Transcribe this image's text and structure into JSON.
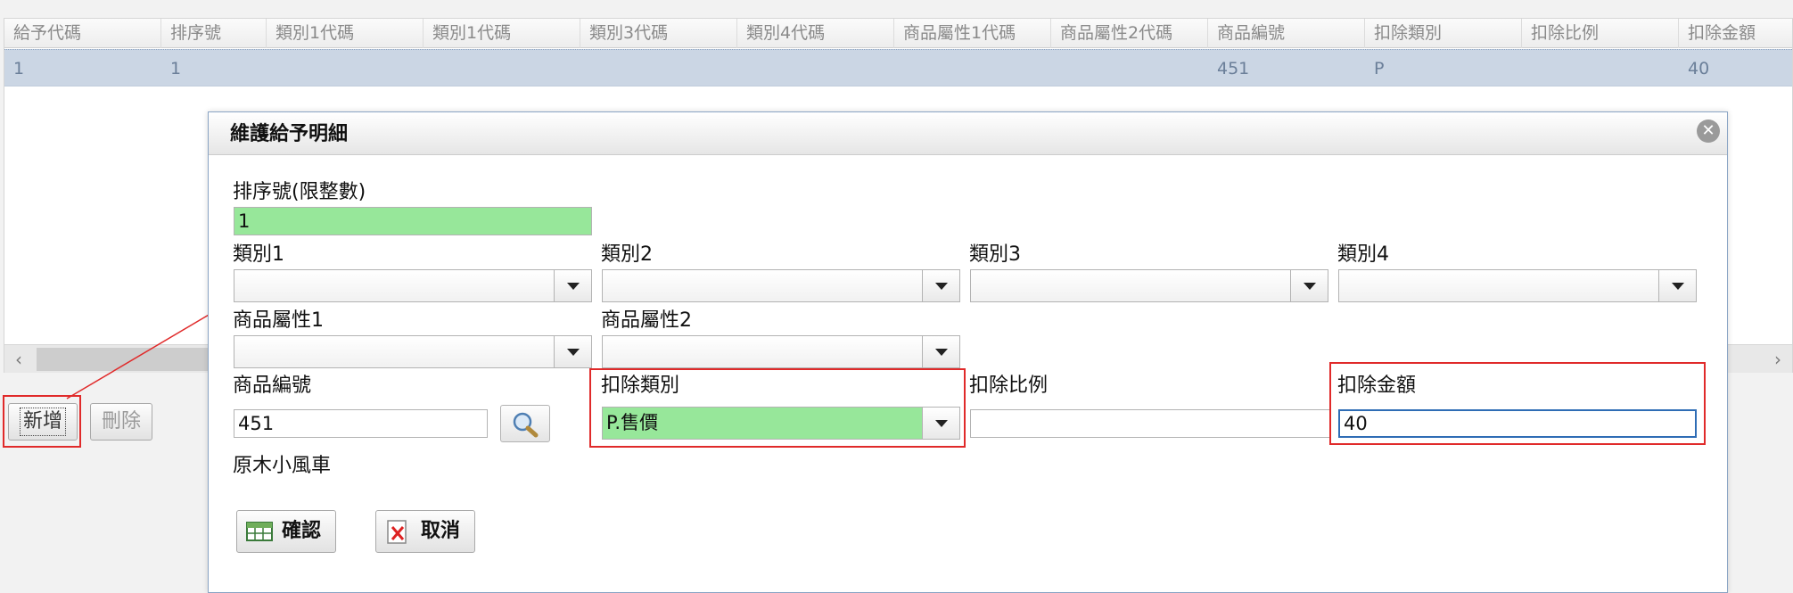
{
  "grid": {
    "columns": [
      "給予代碼",
      "排序號",
      "類別1代碼",
      "類別1代碼",
      "類別3代碼",
      "類別4代碼",
      "商品屬性1代碼",
      "商品屬性2代碼",
      "商品編號",
      "扣除類別",
      "扣除比例",
      "扣除金額"
    ],
    "row": [
      "1",
      "1",
      "",
      "",
      "",
      "",
      "",
      "",
      "451",
      "P",
      "",
      "40"
    ]
  },
  "scrollbar": {
    "left_arrow": "‹",
    "right_arrow": "›"
  },
  "buttons": {
    "add_label": "新增",
    "delete_label": "刪除"
  },
  "dialog": {
    "title": "維護給予明細",
    "close_glyph": "✕",
    "sort_label": "排序號(限整數)",
    "sort_value": "1",
    "cat1_label": "類別1",
    "cat1_value": "",
    "cat2_label": "類別2",
    "cat2_value": "",
    "cat3_label": "類別3",
    "cat3_value": "",
    "cat4_label": "類別4",
    "cat4_value": "",
    "attr1_label": "商品屬性1",
    "attr1_value": "",
    "attr2_label": "商品屬性2",
    "attr2_value": "",
    "product_no_label": "商品編號",
    "product_no_value": "451",
    "product_name": "原木小風車",
    "deduct_type_label": "扣除類別",
    "deduct_type_value": "P.售價",
    "deduct_ratio_label": "扣除比例",
    "deduct_ratio_value": "",
    "deduct_amount_label": "扣除金額",
    "deduct_amount_value": "40",
    "confirm_label": "確認",
    "cancel_label": "取消"
  },
  "colors": {
    "highlight": "#e02a2a",
    "selected_row": "#cbd6e4",
    "required_field": "#97e79a",
    "focus_border": "#2f6db5"
  }
}
